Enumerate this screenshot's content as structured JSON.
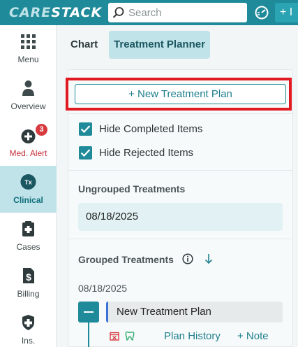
{
  "app": {
    "logo_left": "CARE",
    "logo_right": "STACK"
  },
  "search": {
    "placeholder": "Search"
  },
  "header": {
    "add_label": "+ I"
  },
  "sidebar": {
    "items": [
      {
        "label": "Menu",
        "icon": "grid-icon"
      },
      {
        "label": "Overview",
        "icon": "person-icon"
      },
      {
        "label": "Med. Alert",
        "icon": "plus-circle-icon",
        "badge": "3"
      },
      {
        "label": "Clinical",
        "icon": "tx-icon",
        "icon_text": "Tx",
        "active": true
      },
      {
        "label": "Cases",
        "icon": "clipboard-plus-icon"
      },
      {
        "label": "Billing",
        "icon": "dollar-doc-icon"
      },
      {
        "label": "Ins.",
        "icon": "shield-plus-icon"
      }
    ]
  },
  "tabs": {
    "chart": "Chart",
    "treatment_planner": "Treatment Planner"
  },
  "planner": {
    "new_plan": "+ New Treatment Plan",
    "hide_completed": "Hide Completed Items",
    "hide_rejected": "Hide Rejected Items",
    "ungrouped_title": "Ungrouped Treatments",
    "ungrouped_date": "08/18/2025",
    "grouped_title": "Grouped Treatments",
    "grouped_date": "08/18/2025",
    "plan_name": "New Treatment Plan",
    "plan_history": "Plan History",
    "add_note": "+ Note"
  },
  "colors": {
    "brand": "#1f8a99",
    "highlight": "#e11a22",
    "alert": "#c6303c"
  }
}
